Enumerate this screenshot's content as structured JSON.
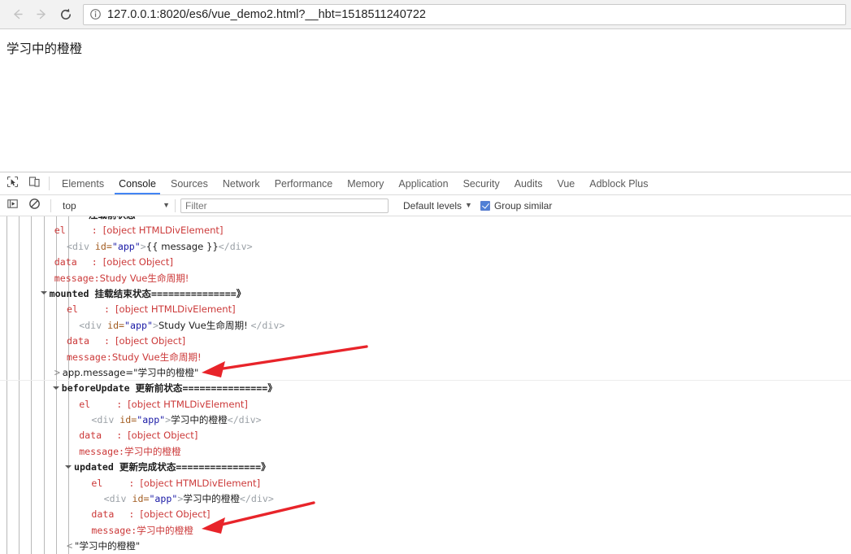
{
  "browser": {
    "back_icon": "arrow-left-icon",
    "forward_icon": "arrow-right-icon",
    "reload_icon": "reload-icon",
    "info_icon": "info-circle-icon",
    "url": "127.0.0.1:8020/es6/vue_demo2.html?__hbt=1518511240722"
  },
  "page": {
    "heading": "学习中的橙橙"
  },
  "devtools": {
    "inspect_icon": "inspect-element-icon",
    "device_icon": "device-toolbar-icon",
    "tabs": [
      {
        "label": "Elements",
        "active": false
      },
      {
        "label": "Console",
        "active": true
      },
      {
        "label": "Sources",
        "active": false
      },
      {
        "label": "Network",
        "active": false
      },
      {
        "label": "Performance",
        "active": false
      },
      {
        "label": "Memory",
        "active": false
      },
      {
        "label": "Application",
        "active": false
      },
      {
        "label": "Security",
        "active": false
      },
      {
        "label": "Audits",
        "active": false
      },
      {
        "label": "Vue",
        "active": false
      },
      {
        "label": "Adblock Plus",
        "active": false
      }
    ],
    "filterbar": {
      "execute_icon": "execute-snippet-icon",
      "clear_icon": "clear-console-icon",
      "context": "top",
      "context_caret": "▼",
      "filter_placeholder": "Filter",
      "filter_value": "",
      "levels_label": "Default levels",
      "levels_caret": "▼",
      "group_similar_label": "Group similar",
      "group_similar_checked": true
    },
    "accent_color": "#4285f4",
    "log_text_color": "#cc3a3a",
    "arrow_color": "#e8242a"
  },
  "console_log": {
    "rows": [
      {
        "id": "r0",
        "indent": 4,
        "kind": "clipped",
        "text": "注载前状态"
      },
      {
        "id": "r1",
        "indent": 4,
        "kind": "kv",
        "key": "el",
        "sep": ":",
        "value": "[object HTMLDivElement]"
      },
      {
        "id": "r2",
        "indent": 5,
        "kind": "html",
        "open": "<div ",
        "attr": "id=",
        "attrval": "\"app\"",
        "gt": ">",
        "content": "{{ message }}",
        "close": "</div>"
      },
      {
        "id": "r3",
        "indent": 4,
        "kind": "kv",
        "key": "data",
        "sep": ":",
        "value": "[object Object]"
      },
      {
        "id": "r4",
        "indent": 4,
        "kind": "kv",
        "key": "message:",
        "sep": "",
        "value": "Study Vue生命周期!"
      },
      {
        "id": "r5",
        "indent": 3,
        "kind": "group",
        "fn": "mounted",
        "cn": "挂载结束状态===============》"
      },
      {
        "id": "r6",
        "indent": 5,
        "kind": "kv",
        "key": "el",
        "sep": ":",
        "value": "[object HTMLDivElement]"
      },
      {
        "id": "r7",
        "indent": 6,
        "kind": "html",
        "open": "<div ",
        "attr": "id=",
        "attrval": "\"app\"",
        "gt": ">",
        "content": "Study Vue生命周期! ",
        "close": "</div>"
      },
      {
        "id": "r8",
        "indent": 5,
        "kind": "kv",
        "key": "data",
        "sep": ":",
        "value": "[object Object]"
      },
      {
        "id": "r9",
        "indent": 5,
        "kind": "kv",
        "key": "message:",
        "sep": "",
        "value": "Study Vue生命周期!"
      },
      {
        "id": "r10",
        "indent": 4,
        "kind": "input",
        "prompt": ">",
        "text": "app.message=\"学习中的橙橙\""
      },
      {
        "id": "r11",
        "indent": 4,
        "kind": "group",
        "fn": "beforeUpdate",
        "cn": "更新前状态===============》"
      },
      {
        "id": "r12",
        "indent": 6,
        "kind": "kv",
        "key": "el",
        "sep": ":",
        "value": "[object HTMLDivElement]"
      },
      {
        "id": "r13",
        "indent": 7,
        "kind": "html",
        "open": "<div ",
        "attr": "id=",
        "attrval": "\"app\"",
        "gt": ">",
        "content": "学习中的橙橙",
        "close": "</div>"
      },
      {
        "id": "r14",
        "indent": 6,
        "kind": "kv",
        "key": "data",
        "sep": ":",
        "value": "[object Object]"
      },
      {
        "id": "r15",
        "indent": 6,
        "kind": "kv",
        "key": "message:",
        "sep": "",
        "value": "学习中的橙橙"
      },
      {
        "id": "r16",
        "indent": 5,
        "kind": "group",
        "fn": "updated",
        "cn": "更新完成状态===============》"
      },
      {
        "id": "r17",
        "indent": 7,
        "kind": "kv",
        "key": "el",
        "sep": ":",
        "value": "[object HTMLDivElement]"
      },
      {
        "id": "r18",
        "indent": 8,
        "kind": "html",
        "open": "<div ",
        "attr": "id=",
        "attrval": "\"app\"",
        "gt": ">",
        "content": "学习中的橙橙",
        "close": "</div>"
      },
      {
        "id": "r19",
        "indent": 7,
        "kind": "kv",
        "key": "data",
        "sep": ":",
        "value": "[object Object]"
      },
      {
        "id": "r20",
        "indent": 7,
        "kind": "kv",
        "key": "message:",
        "sep": "",
        "value": "学习中的橙橙"
      },
      {
        "id": "r21",
        "indent": 5,
        "kind": "output",
        "prompt": "<",
        "text": "\"学习中的橙橙\""
      }
    ],
    "rails_x": [
      8,
      23,
      38,
      54,
      69,
      84
    ]
  },
  "annotations": [
    {
      "id": "a1",
      "label": "arrow-pointing-to-app-message-command"
    },
    {
      "id": "a2",
      "label": "arrow-pointing-to-updated-message-value"
    }
  ]
}
